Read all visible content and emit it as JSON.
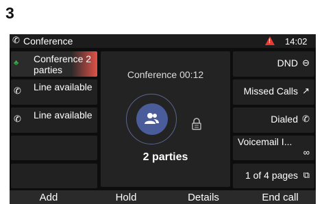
{
  "step_number": "3",
  "status_bar": {
    "title": "Conference",
    "time": "14:02",
    "warning_icon": "warning-icon"
  },
  "line_keys": [
    {
      "label": "Conference 2 parties",
      "icon": "conference-icon",
      "icon_color": "#3aa84a",
      "highlight": "#e25148"
    },
    {
      "label": "Line available",
      "icon": "phone-icon"
    },
    {
      "label": "Line available",
      "icon": "phone-icon"
    },
    {
      "label": ""
    },
    {
      "label": ""
    }
  ],
  "call": {
    "title": "Conference 00:12",
    "parties": "2 parties",
    "avatar_color": "#4a5d9a"
  },
  "right_keys": [
    {
      "label": "DND",
      "icon": "dnd-icon"
    },
    {
      "label": "Missed Calls",
      "icon": "missed-calls-icon"
    },
    {
      "label": "Dialed",
      "icon": "dialed-icon"
    },
    {
      "label": "Voicemail I...",
      "icon": "voicemail-icon"
    },
    {
      "label": "1 of 4 pages",
      "icon": "pages-icon"
    }
  ],
  "softkeys": [
    "Add",
    "Hold",
    "Details",
    "End call"
  ]
}
